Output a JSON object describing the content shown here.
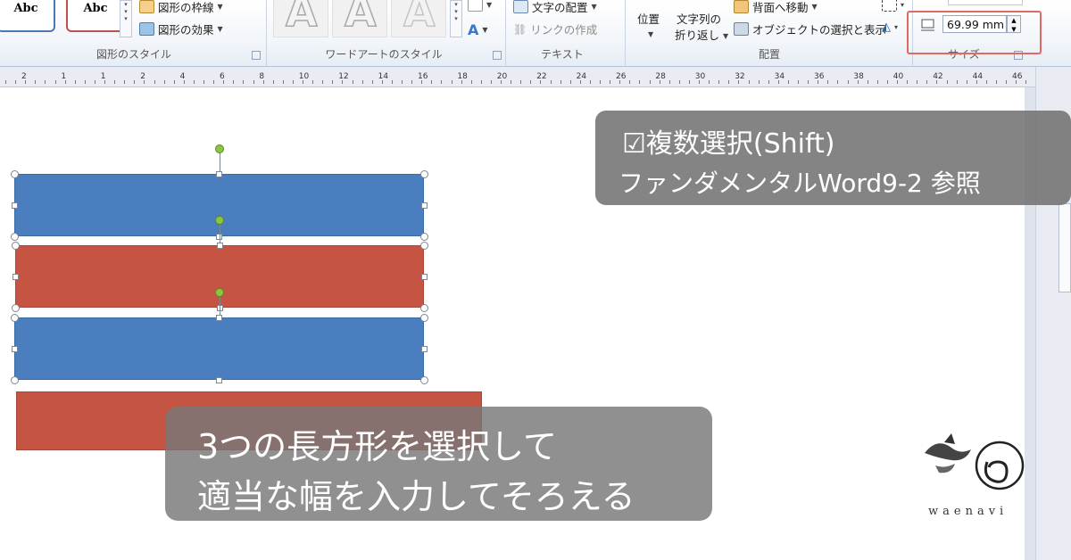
{
  "ribbon": {
    "shape_styles": {
      "tile1": "Abc",
      "tile2": "Abc",
      "outline_label": "図形の枠線",
      "effects_label": "図形の効果",
      "group_label": "図形のスタイル"
    },
    "wordart": {
      "letter": "A",
      "group_label": "ワードアートのスタイル"
    },
    "text": {
      "align_label": "文字の配置",
      "link_label": "リンクの作成",
      "group_label": "テキスト"
    },
    "arrange": {
      "position_label": "位置",
      "wrap_label_1": "文字列の",
      "wrap_label_2": "折り返し",
      "send_back_label": "背面へ移動",
      "selection_pane_label": "オブジェクトの選択と表示",
      "group_label": "配置"
    },
    "size": {
      "width_value": "69.99 mm",
      "group_label": "サイズ"
    }
  },
  "ruler": {
    "numbers": [
      "2",
      "1",
      "1",
      "2",
      "4",
      "6",
      "8",
      "10",
      "12",
      "14",
      "16",
      "18",
      "20",
      "22",
      "24",
      "26",
      "28",
      "30",
      "32",
      "34",
      "36",
      "38",
      "40",
      "42",
      "44",
      "46",
      "48"
    ]
  },
  "overlay_note": {
    "line1": "☑複数選択(Shift)",
    "line2": "ファンダメンタルWord9-2 参照"
  },
  "caption": {
    "line1": "3つの長方形を選択して",
    "line2": "適当な幅を入力してそろえる"
  },
  "logo": {
    "text": "waenavi"
  },
  "colors": {
    "shape_blue": "#4a7ebf",
    "shape_red": "#c65443",
    "highlight": "#e06a63",
    "rotation_handle": "#8cc63f"
  }
}
